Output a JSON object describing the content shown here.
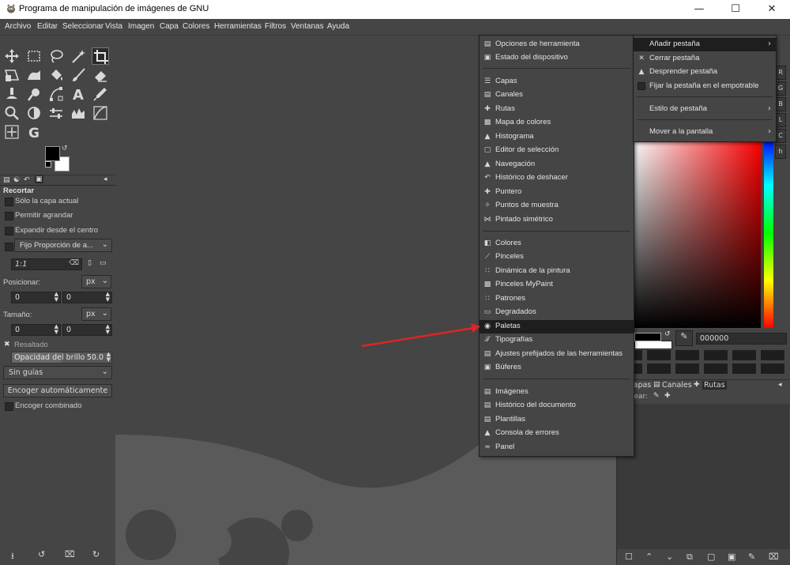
{
  "window": {
    "title": "Programa de manipulación de imágenes de GNU"
  },
  "menubar": [
    "Archivo",
    "Editar",
    "Seleccionar",
    "Vista",
    "Imagen",
    "Capa",
    "Colores",
    "Herramientas",
    "Filtros",
    "Ventanas",
    "Ayuda"
  ],
  "tool_options": {
    "title": "Recortar",
    "only_current_layer": "Sólo la capa actual",
    "allow_growing": "Permitir agrandar",
    "expand_from_center": "Expandir desde el centro",
    "fixed_dropdown": "Fijo Proporción de a...",
    "ratio_value": "1:1",
    "position_label": "Posicionar:",
    "position_unit": "px",
    "position_x": "0",
    "position_y": "0",
    "size_label": "Tamaño:",
    "size_unit": "px",
    "size_w": "0",
    "size_h": "0",
    "highlight": "Resaltado",
    "brightness_label": "Opacidad del brillo",
    "brightness_value": "50.0",
    "guides": "Sin guías",
    "auto_shrink": "Encoger automáticamente",
    "shrink_merged": "Encoger combinado"
  },
  "dock_menu": {
    "groups": [
      [
        "Opciones de herramienta",
        "Estado del dispositivo"
      ],
      [
        "Capas",
        "Canales",
        "Rutas",
        "Mapa de colores",
        "Histograma",
        "Editor de selección",
        "Navegación",
        "Histórico de deshacer",
        "Puntero",
        "Puntos de muestra",
        "Pintado simétrico"
      ],
      [
        "Colores",
        "Pinceles",
        "Dinámica de la pintura",
        "Pinceles MyPaint",
        "Patrones",
        "Degradados",
        "Paletas",
        "Tipografías",
        "Ajustes prefijados de las herramientas",
        "Búferes"
      ],
      [
        "Imágenes",
        "Histórico del documento",
        "Plantillas",
        "Consola de errores",
        "Panel"
      ]
    ],
    "highlighted": "Paletas"
  },
  "tab_menu": {
    "add_tab": "Añadir pestaña",
    "close_tab": "Cerrar pestaña",
    "detach_tab": "Desprender pestaña",
    "lock_tab": "Fijar la pestaña en el empotrable",
    "tab_style": "Estilo de pestaña",
    "move_to_screen": "Mover a la pantalla"
  },
  "right_dock": {
    "side_tabs": [
      "R",
      "G",
      "B",
      "L",
      "C",
      "h"
    ],
    "hex_value": "000000",
    "layers_tabs": [
      "Capas",
      "Canales",
      "Rutas"
    ],
    "lock_label": "quear:"
  },
  "colors": {
    "highlight": "#1e1e1e",
    "arrow": "#e02424",
    "titlebar_border": "#0078d7"
  }
}
